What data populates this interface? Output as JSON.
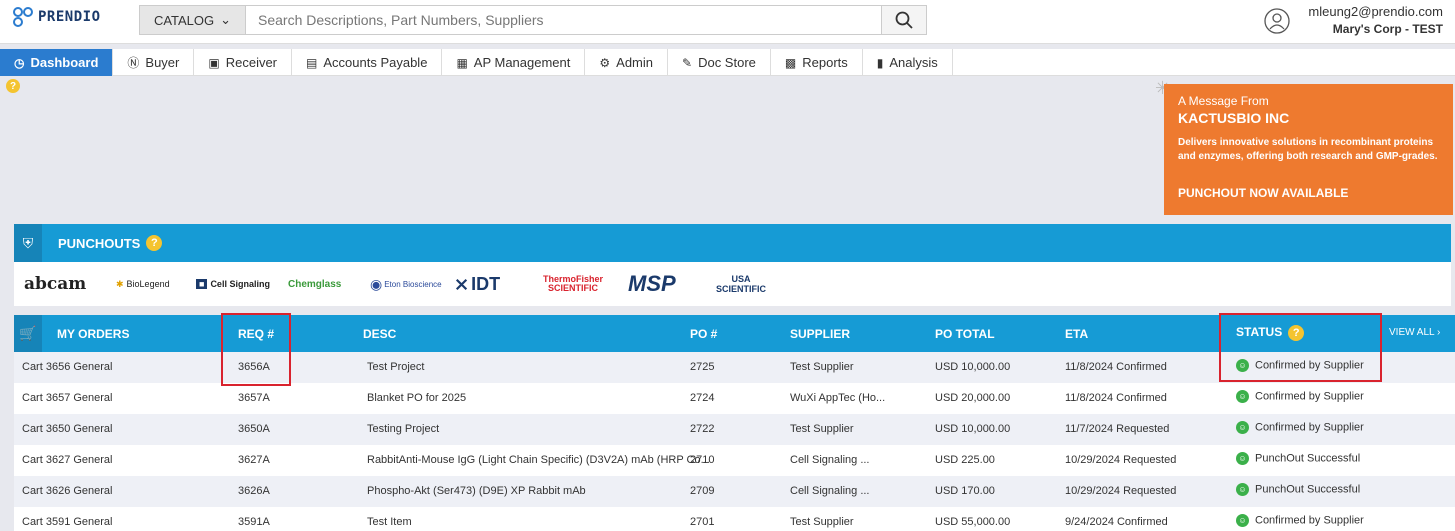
{
  "header": {
    "logo_text": "PRENDIO",
    "catalog_label": "CATALOG",
    "search_placeholder": "Search Descriptions, Part Numbers, Suppliers",
    "user_email": "mleung2@prendio.com",
    "user_org": "Mary's Corp - TEST"
  },
  "nav": [
    {
      "label": "Dashboard",
      "icon": "dashboard-icon",
      "active": true
    },
    {
      "label": "Buyer",
      "icon": "dollar-icon"
    },
    {
      "label": "Receiver",
      "icon": "calendar-icon"
    },
    {
      "label": "Accounts Payable",
      "icon": "document-icon"
    },
    {
      "label": "AP Management",
      "icon": "calculator-icon"
    },
    {
      "label": "Admin",
      "icon": "gear-icon"
    },
    {
      "label": "Doc Store",
      "icon": "pen-icon"
    },
    {
      "label": "Reports",
      "icon": "report-icon"
    },
    {
      "label": "Analysis",
      "icon": "bar-chart-icon"
    }
  ],
  "message": {
    "from_label": "A Message From",
    "company": "KACTUSBIO INC",
    "body": "Delivers innovative solutions in recombinant proteins and enzymes, offering both research and GMP-grades.",
    "cta": "PUNCHOUT NOW AVAILABLE"
  },
  "punchouts": {
    "title": "PUNCHOUTS",
    "help": "?",
    "vendors": [
      "abcam",
      "BioLegend",
      "Cell Signaling",
      "Chemglass",
      "Eton Bioscience",
      "IDT",
      "ThermoFisher SCIENTIFIC",
      "MSP",
      "USA SCIENTIFIC"
    ]
  },
  "orders": {
    "title": "MY ORDERS",
    "columns": {
      "req": "REQ #",
      "desc": "DESC",
      "po": "PO #",
      "supplier": "SUPPLIER",
      "po_total": "PO TOTAL",
      "eta": "ETA",
      "status": "STATUS"
    },
    "view_all": "VIEW ALL",
    "rows": [
      {
        "cart": "Cart 3656 General",
        "req": "3656A",
        "desc": "Test Project",
        "po": "2725",
        "supplier": "Test Supplier",
        "total": "USD 10,000.00",
        "eta": "11/8/2024 Confirmed",
        "status": "Confirmed by Supplier"
      },
      {
        "cart": "Cart 3657 General",
        "req": "3657A",
        "desc": "Blanket PO for 2025",
        "po": "2724",
        "supplier": "WuXi AppTec (Ho...",
        "total": "USD 20,000.00",
        "eta": "11/8/2024 Confirmed",
        "status": "Confirmed by Supplier"
      },
      {
        "cart": "Cart 3650 General",
        "req": "3650A",
        "desc": "Testing Project",
        "po": "2722",
        "supplier": "Test Supplier",
        "total": "USD 10,000.00",
        "eta": "11/7/2024 Requested",
        "status": "Confirmed by Supplier"
      },
      {
        "cart": "Cart 3627 General",
        "req": "3627A",
        "desc": "RabbitAnti-Mouse IgG (Light Chain Specific) (D3V2A) mAb (HRP Co...",
        "po": "2710",
        "supplier": "Cell Signaling ...",
        "total": "USD 225.00",
        "eta": "10/29/2024 Requested",
        "status": "PunchOut Successful"
      },
      {
        "cart": "Cart 3626 General",
        "req": "3626A",
        "desc": "Phospho-Akt (Ser473) (D9E) XP Rabbit mAb",
        "po": "2709",
        "supplier": "Cell Signaling ...",
        "total": "USD 170.00",
        "eta": "10/29/2024 Requested",
        "status": "PunchOut Successful"
      },
      {
        "cart": "Cart 3591 General",
        "req": "3591A",
        "desc": "Test Item",
        "po": "2701",
        "supplier": "Test Supplier",
        "total": "USD 55,000.00",
        "eta": "9/24/2024 Confirmed",
        "status": "Confirmed by Supplier"
      }
    ]
  },
  "colors": {
    "primary": "#169bd5",
    "nav_active": "#2b7ccf",
    "message_bg": "#ee7a2f",
    "status_green": "#3bb04a",
    "highlight_red": "#d9232e"
  }
}
